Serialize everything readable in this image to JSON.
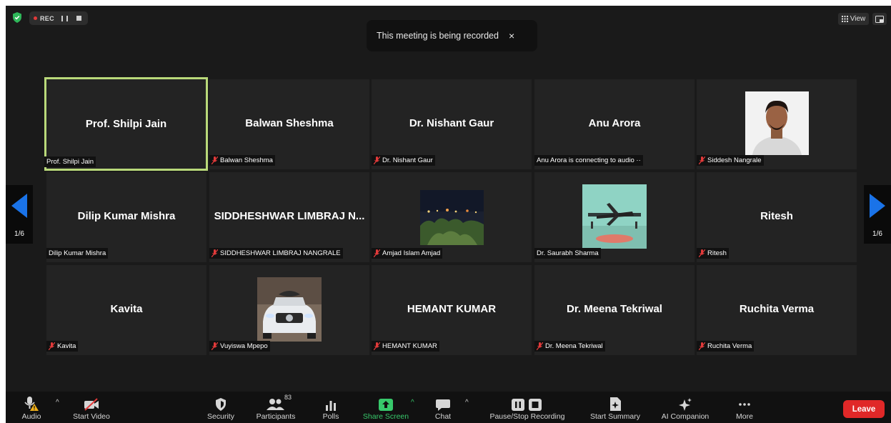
{
  "top_bar": {
    "rec_label": "REC",
    "toast_message": "This meeting is being recorded",
    "toast_close": "×",
    "view_label": "View"
  },
  "pager": {
    "left_count": "1/6",
    "right_count": "1/6"
  },
  "tiles": [
    {
      "center": "Prof. Shilpi Jain",
      "nameplate": "Prof. Shilpi Jain",
      "muted": false
    },
    {
      "center": "Balwan Sheshma",
      "nameplate": "Balwan Sheshma",
      "muted": true
    },
    {
      "center": "Dr. Nishant Gaur",
      "nameplate": "Dr. Nishant Gaur",
      "muted": true
    },
    {
      "center": "Anu Arora",
      "nameplate": "Anu Arora is connecting to audio ··",
      "muted": false
    },
    {
      "center": "",
      "nameplate": "Siddesh Nangrale",
      "muted": true
    },
    {
      "center": "Dilip Kumar Mishra",
      "nameplate": "Dilip Kumar Mishra",
      "muted": false
    },
    {
      "center": "SIDDHESHWAR LIMBRAJ N...",
      "nameplate": "SIDDHESHWAR LIMBRAJ NANGRALE",
      "muted": true
    },
    {
      "center": "",
      "nameplate": "Amjad Islam Amjad",
      "muted": true
    },
    {
      "center": "",
      "nameplate": "Dr. Saurabh Sharma",
      "muted": false
    },
    {
      "center": "Ritesh",
      "nameplate": "Ritesh",
      "muted": true
    },
    {
      "center": "Kavita",
      "nameplate": "Kavita",
      "muted": true
    },
    {
      "center": "",
      "nameplate": "Vuyiswa Mpepo",
      "muted": true
    },
    {
      "center": "HEMANT KUMAR",
      "nameplate": "HEMANT KUMAR",
      "muted": true
    },
    {
      "center": "Dr. Meena Tekriwal",
      "nameplate": "Dr. Meena Tekriwal",
      "muted": true
    },
    {
      "center": "Ruchita Verma",
      "nameplate": "Ruchita Verma",
      "muted": true
    }
  ],
  "toolbar": {
    "audio": "Audio",
    "start_video": "Start Video",
    "security": "Security",
    "participants": "Participants",
    "participants_count": "83",
    "polls": "Polls",
    "share_screen": "Share Screen",
    "chat": "Chat",
    "pause_stop_recording": "Pause/Stop Recording",
    "start_summary": "Start Summary",
    "ai_companion": "AI Companion",
    "more": "More",
    "leave": "Leave"
  },
  "colors": {
    "active_speaker_border": "#b9d97a",
    "share_green": "#37c96b",
    "leave_red": "#e02828",
    "pager_blue": "#1a73e8"
  }
}
